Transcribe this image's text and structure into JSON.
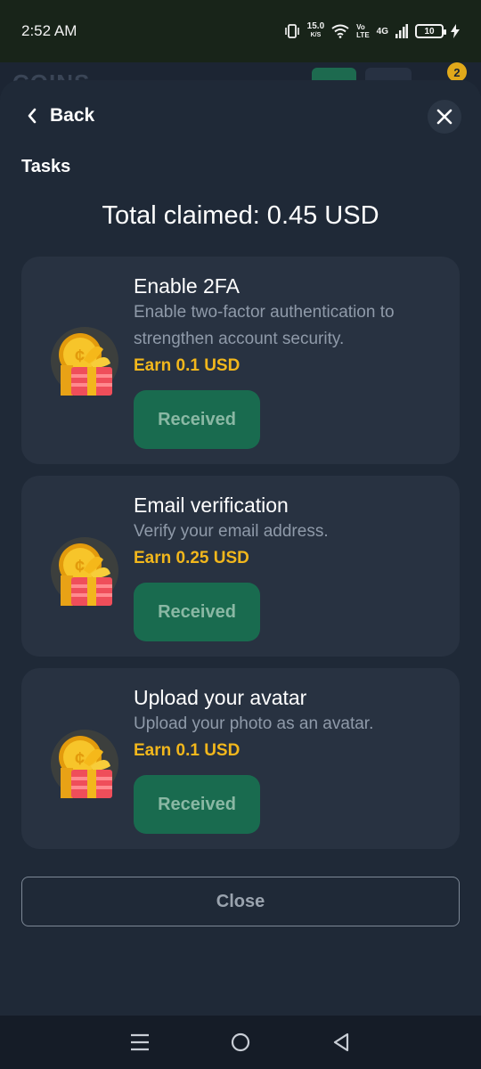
{
  "status_bar": {
    "time": "2:52 AM",
    "speed_value": "15.0",
    "speed_unit": "K/S",
    "volte_top": "Vo",
    "volte_bottom": "LTE",
    "network": "4G",
    "battery": "10"
  },
  "background_app": {
    "logo": "COINS",
    "badge_count": "2"
  },
  "modal": {
    "back_label": "Back",
    "section_title": "Tasks",
    "total_claimed": "Total claimed: 0.45 USD",
    "close_label": "Close"
  },
  "tasks": [
    {
      "title": "Enable 2FA",
      "description": "Enable two-factor authentication to strengthen account security.",
      "reward": "Earn 0.1 USD",
      "status_label": "Received"
    },
    {
      "title": "Email verification",
      "description": "Verify your email address.",
      "reward": "Earn 0.25 USD",
      "status_label": "Received"
    },
    {
      "title": "Upload your avatar",
      "description": "Upload your photo as an avatar.",
      "reward": "Earn 0.1 USD",
      "status_label": "Received"
    }
  ],
  "colors": {
    "accent_gold": "#f2b71c",
    "received_green": "#196b4f",
    "card_bg": "#283241",
    "sheet_bg": "#1f2937"
  },
  "icons": {
    "task_icon": "gift-coin-icon",
    "back": "chevron-left-icon",
    "close": "close-icon"
  }
}
